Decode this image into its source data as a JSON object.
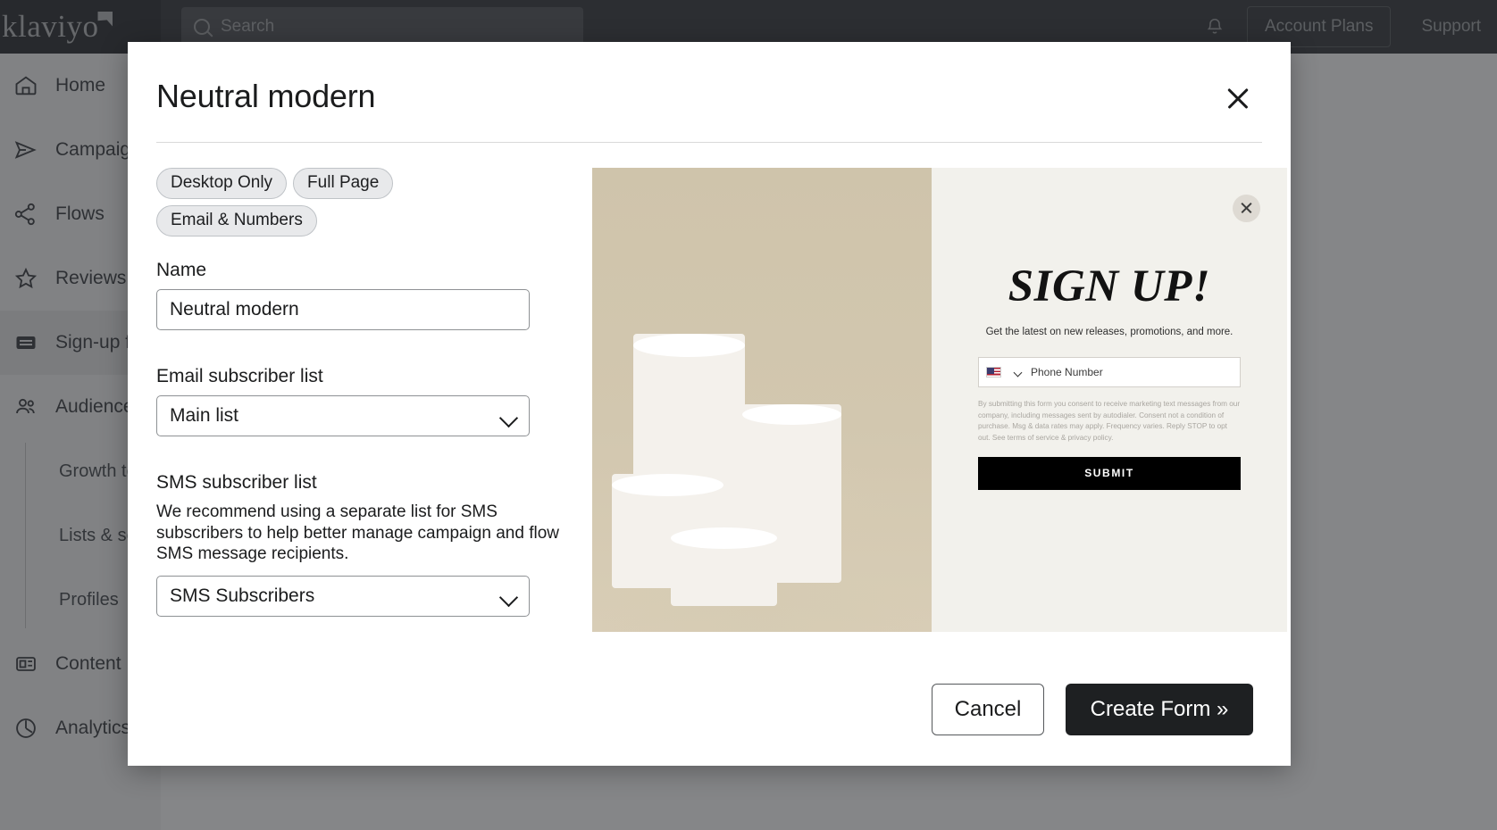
{
  "topbar": {
    "logo_text": "klaviyo",
    "search_placeholder": "Search",
    "notifications_icon": "bell-icon",
    "account_plans_label": "Account Plans",
    "support_label": "Support"
  },
  "sidebar": {
    "items": [
      {
        "label": "Home",
        "icon": "home-icon"
      },
      {
        "label": "Campaigns",
        "icon": "paper-plane-icon"
      },
      {
        "label": "Flows",
        "icon": "flows-icon"
      },
      {
        "label": "Reviews",
        "icon": "star-icon"
      },
      {
        "label": "Sign-up forms",
        "icon": "signup-forms-icon",
        "active": true
      },
      {
        "label": "Audience",
        "icon": "people-icon"
      }
    ],
    "sub_items": [
      {
        "label": "Growth tools"
      },
      {
        "label": "Lists & segments"
      },
      {
        "label": "Profiles"
      }
    ],
    "items_after": [
      {
        "label": "Content",
        "icon": "content-icon"
      },
      {
        "label": "Analytics",
        "icon": "analytics-icon"
      }
    ]
  },
  "modal": {
    "title": "Neutral modern",
    "close_icon": "close-icon",
    "tags": [
      "Desktop Only",
      "Full Page",
      "Email & Numbers"
    ],
    "fields": {
      "name": {
        "label": "Name",
        "value": "Neutral modern"
      },
      "email_list": {
        "label": "Email subscriber list",
        "value": "Main list",
        "chevron_icon": "chevron-down-icon"
      },
      "sms_list": {
        "label": "SMS subscriber list",
        "help": "We recommend using a separate list for SMS subscribers to help better manage campaign and flow SMS message recipients.",
        "value": "SMS Subscribers",
        "chevron_icon": "chevron-down-icon"
      }
    },
    "footer": {
      "cancel_label": "Cancel",
      "create_label": "Create Form »"
    }
  },
  "preview": {
    "close_icon": "close-icon",
    "headline": "SIGN UP!",
    "subhead": "Get the latest on new releases, promotions, and more.",
    "phone_placeholder": "Phone Number",
    "country_flag": "us-flag-icon",
    "country_chevron": "chevron-down-icon",
    "fine_print": "By submitting this form you consent to receive marketing text messages from our company, including messages sent by autodialer. Consent not a condition of purchase. Msg & data rates may apply. Frequency varies. Reply STOP to opt out. See terms of service & privacy policy.",
    "submit_label": "SUBMIT"
  },
  "colors": {
    "topbar_bg": "#3b3d40",
    "modal_bg": "#ffffff",
    "primary_button": "#1e2022",
    "preview_panel_bg": "#f2f1ec",
    "preview_photo_bg": "#d2c7af"
  }
}
